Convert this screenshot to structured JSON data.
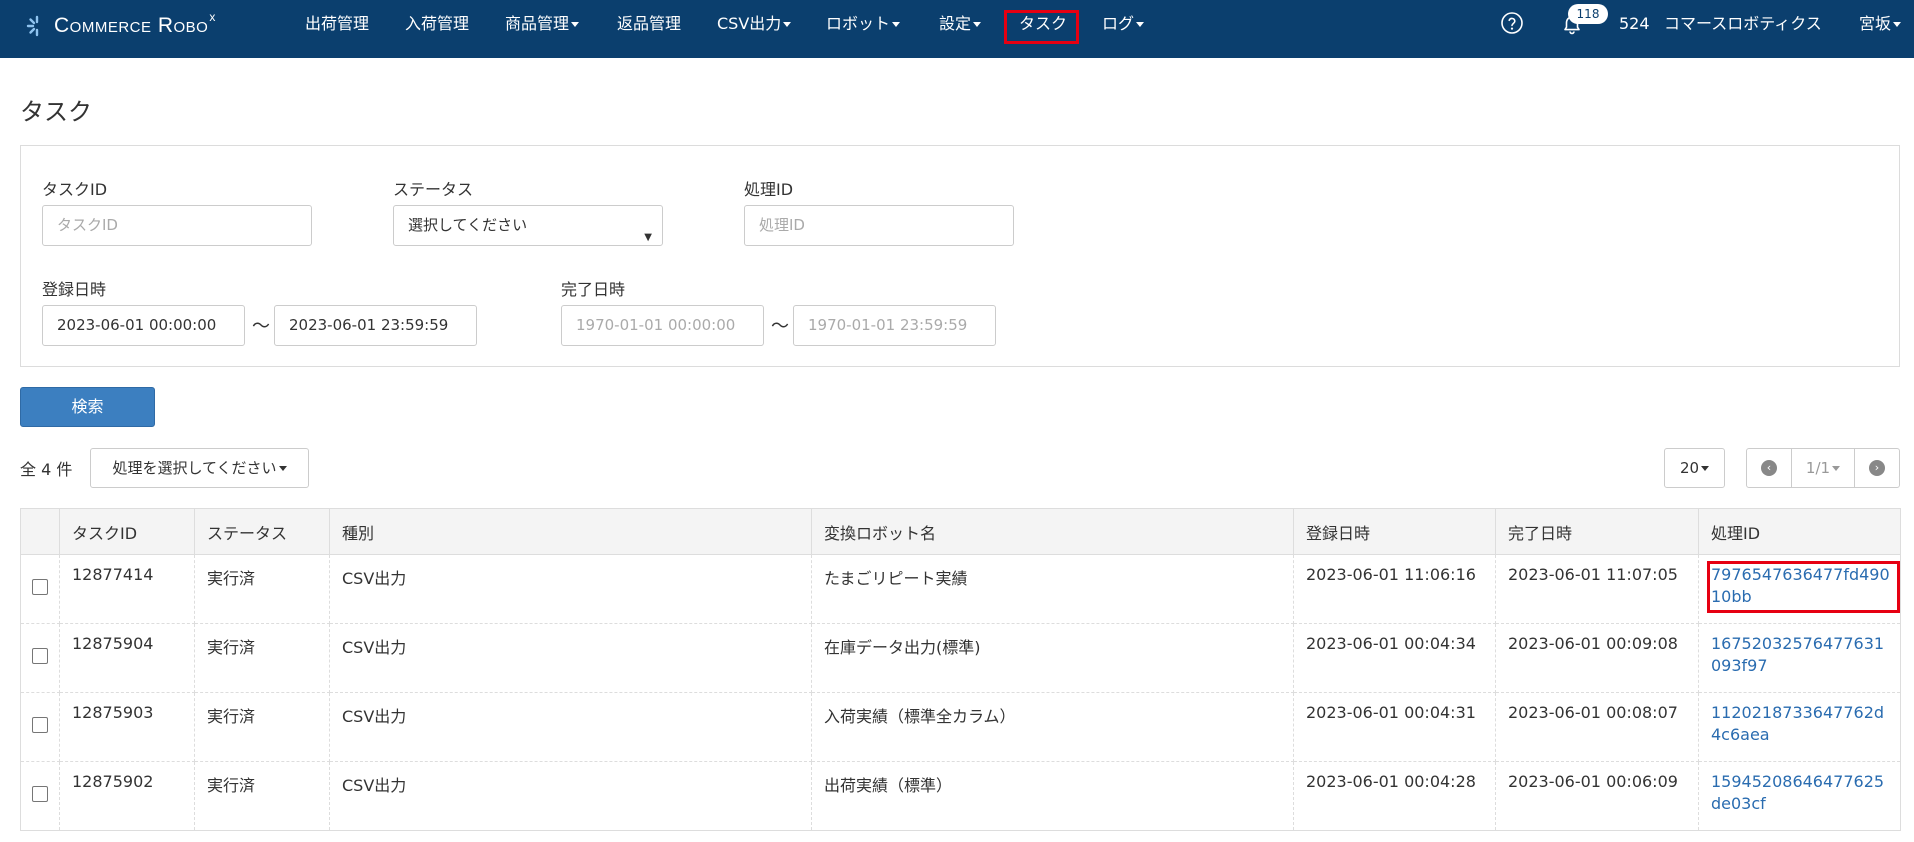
{
  "brand": {
    "name": "Commerce Robo",
    "mark": "x"
  },
  "nav": {
    "items": [
      {
        "label": "出荷管理"
      },
      {
        "label": "入荷管理"
      },
      {
        "label": "商品管理"
      },
      {
        "label": "返品管理"
      },
      {
        "label": "CSV出力"
      },
      {
        "label": "ロボット"
      },
      {
        "label": "設定"
      },
      {
        "label": "タスク"
      },
      {
        "label": "ログ"
      }
    ],
    "notification_count": "118",
    "account_no": "524",
    "company": "コマースロボティクス",
    "user": "宮坂"
  },
  "page": {
    "title": "タスク"
  },
  "filters": {
    "task_id": {
      "label": "タスクID",
      "placeholder": "タスクID"
    },
    "status": {
      "label": "ステータス",
      "value": "選択してください"
    },
    "process_id": {
      "label": "処理ID",
      "placeholder": "処理ID"
    },
    "registered": {
      "label": "登録日時",
      "from": "2023-06-01 00:00:00",
      "to": "2023-06-01 23:59:59"
    },
    "completed": {
      "label": "完了日時",
      "from_placeholder": "1970-01-01 00:00:00",
      "to_placeholder": "1970-01-01 23:59:59"
    },
    "range_separator": "〜",
    "search_button": "検索"
  },
  "toolbar": {
    "total": "全 4 件",
    "action_select": "処理を選択してください",
    "page_size": "20",
    "page_indicator": "1/1"
  },
  "table": {
    "columns": [
      "タスクID",
      "ステータス",
      "種別",
      "変換ロボット名",
      "登録日時",
      "完了日時",
      "処理ID"
    ],
    "rows": [
      {
        "task_id": "12877414",
        "status": "実行済",
        "type": "CSV出力",
        "robot": "たまごリピート実績",
        "registered": "2023-06-01 11:06:16",
        "completed": "2023-06-01 11:07:05",
        "process_id": "7976547636477fd49010bb"
      },
      {
        "task_id": "12875904",
        "status": "実行済",
        "type": "CSV出力",
        "robot": "在庫データ出力(標準)",
        "registered": "2023-06-01 00:04:34",
        "completed": "2023-06-01 00:09:08",
        "process_id": "16752032576477631093f97"
      },
      {
        "task_id": "12875903",
        "status": "実行済",
        "type": "CSV出力",
        "robot": "入荷実績（標準全カラム）",
        "registered": "2023-06-01 00:04:31",
        "completed": "2023-06-01 00:08:07",
        "process_id": "1120218733647762d4c6aea"
      },
      {
        "task_id": "12875902",
        "status": "実行済",
        "type": "CSV出力",
        "robot": "出荷実績（標準）",
        "registered": "2023-06-01 00:04:28",
        "completed": "2023-06-01 00:06:09",
        "process_id": "15945208646477625de03cf"
      }
    ]
  },
  "colors": {
    "navbar": "#0b3f6e",
    "primary_button": "#3c7fc0",
    "link": "#2a6cb0",
    "highlight": "#e60012"
  }
}
